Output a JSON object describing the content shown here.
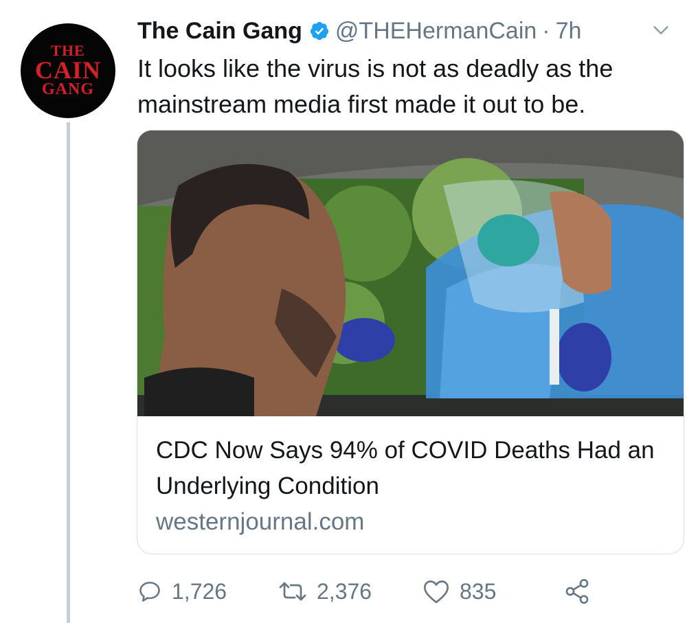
{
  "tweet": {
    "author": {
      "name": "The Cain Gang",
      "handle": "@THEHermanCain",
      "separator": "·",
      "time": "7h",
      "avatar_text": [
        "THE",
        "CAIN",
        "GANG"
      ],
      "verified": true
    },
    "text": "It looks like the virus is not as deadly as the mainstream media first made it out to be.",
    "card": {
      "title": "CDC Now Says 94% of COVID Deaths Had an Underlying Condition",
      "domain": "westernjournal.com"
    },
    "actions": {
      "replies": "1,726",
      "retweets": "2,376",
      "likes": "835"
    }
  },
  "icons": {
    "verified": "verified-badge-icon",
    "caret": "chevron-down-icon",
    "reply": "reply-icon",
    "retweet": "retweet-icon",
    "like": "heart-icon",
    "share": "share-icon"
  },
  "colors": {
    "brand_blue": "#1da1f2",
    "muted_text": "#657786",
    "avatar_red": "#d61f26",
    "avatar_bg": "#050505",
    "card_border": "#d7dde2"
  }
}
